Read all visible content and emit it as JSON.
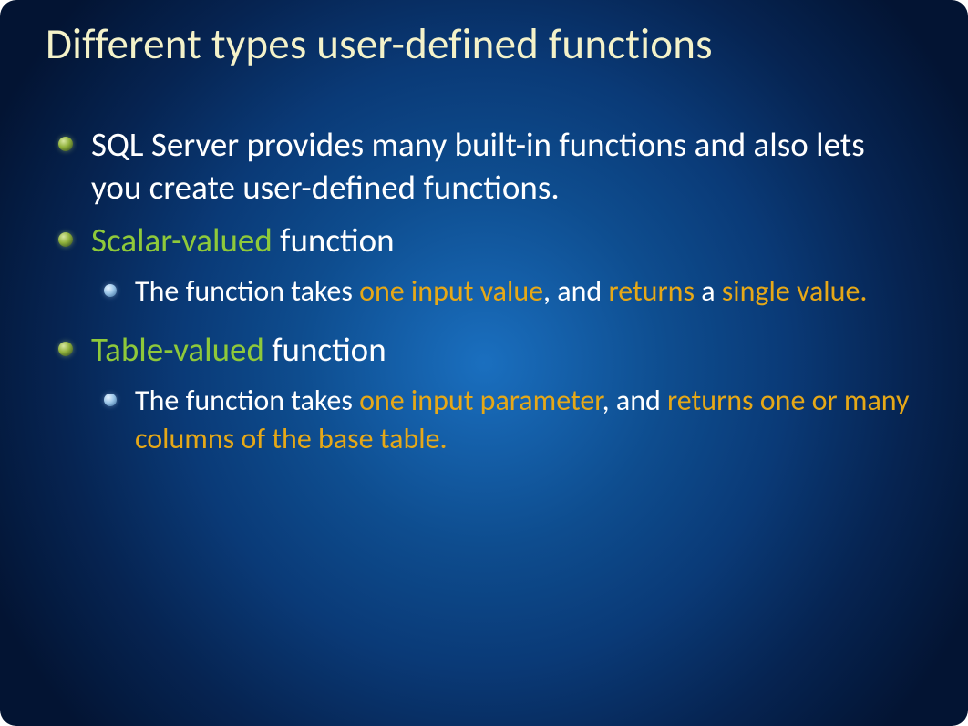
{
  "title": "Different types user-defined functions",
  "items": [
    {
      "level": 1,
      "runs": [
        {
          "text": "SQL Server provides many built-in functions and also lets you create user-defined functions.",
          "color": "white"
        }
      ]
    },
    {
      "level": 1,
      "runs": [
        {
          "text": "Scalar-valued",
          "color": "green"
        },
        {
          "text": " function",
          "color": "white"
        }
      ]
    },
    {
      "level": 2,
      "runs": [
        {
          "text": "The function takes ",
          "color": "white"
        },
        {
          "text": "one input value",
          "color": "orange"
        },
        {
          "text": ", and ",
          "color": "white"
        },
        {
          "text": "returns",
          "color": "orange"
        },
        {
          "text": " a ",
          "color": "white"
        },
        {
          "text": "single value.",
          "color": "orange"
        }
      ]
    },
    {
      "level": 1,
      "runs": [
        {
          "text": "Table-valued",
          "color": "green"
        },
        {
          "text": " function",
          "color": "white"
        }
      ]
    },
    {
      "level": 2,
      "runs": [
        {
          "text": "The function takes ",
          "color": "white"
        },
        {
          "text": "one input parameter",
          "color": "orange"
        },
        {
          "text": ", and ",
          "color": "white"
        },
        {
          "text": "returns one or many columns of the base table.",
          "color": "orange"
        }
      ]
    }
  ]
}
